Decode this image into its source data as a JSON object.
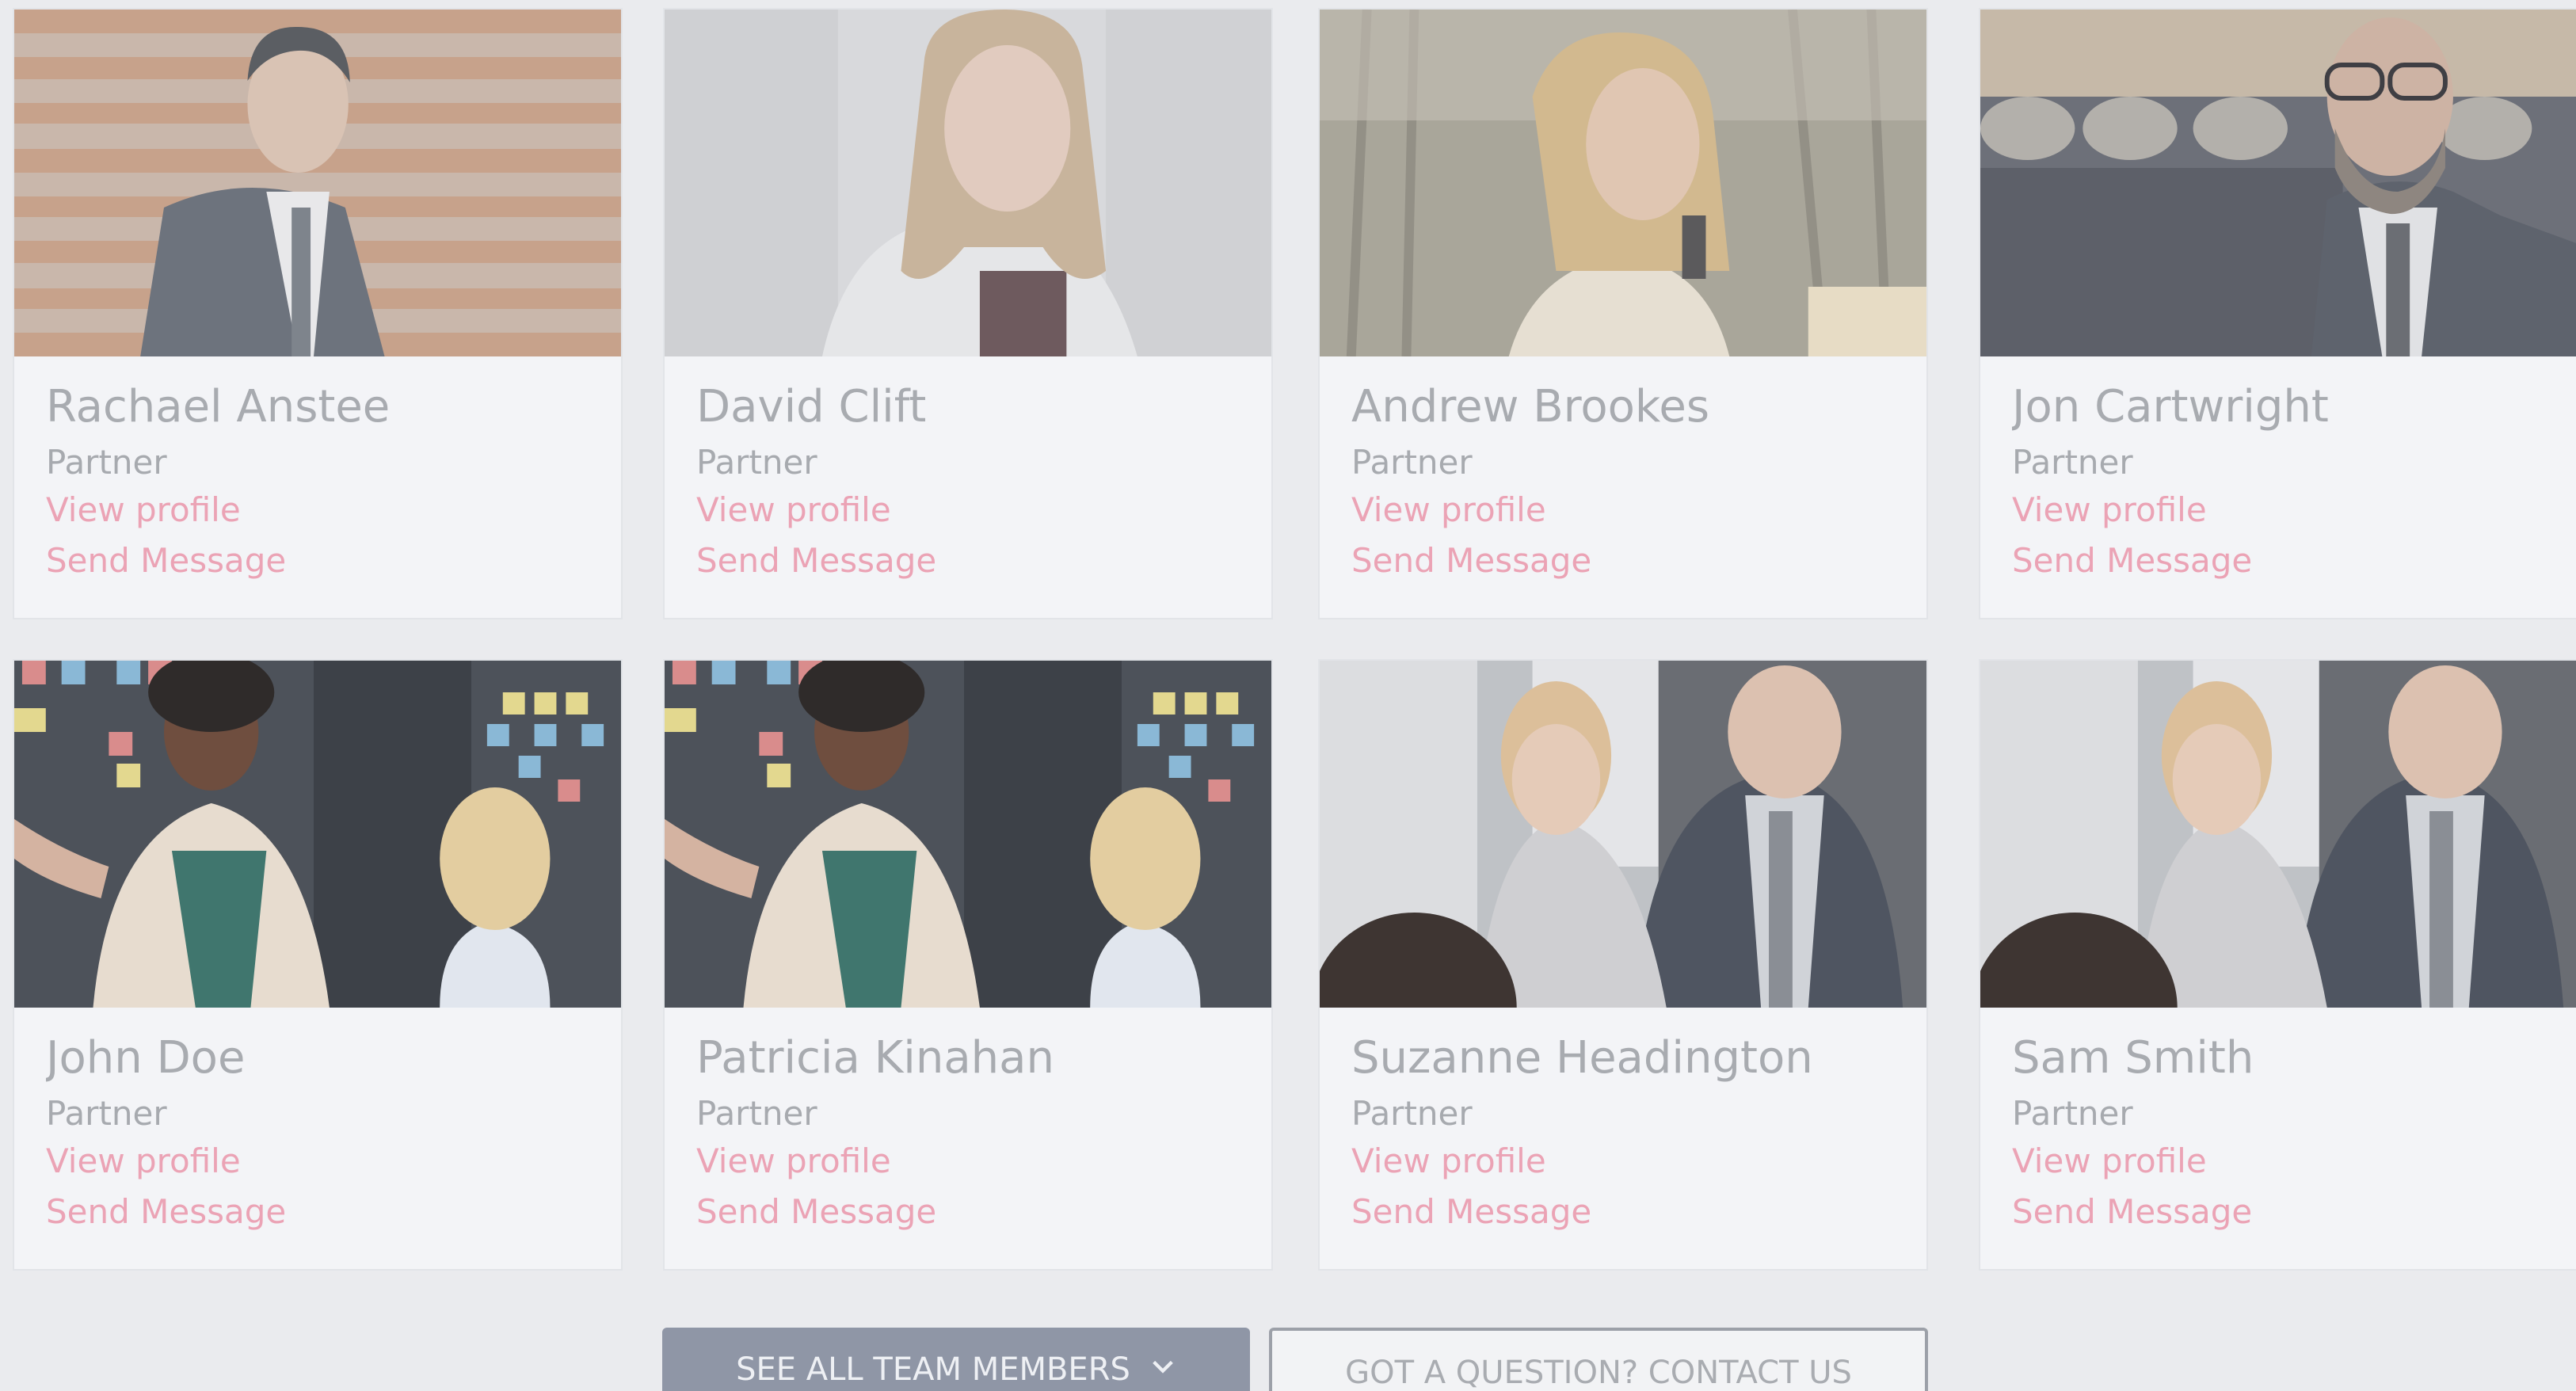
{
  "team": [
    {
      "name": "Rachael Anstee",
      "role": "Partner",
      "view_label": "View profile",
      "message_label": "Send Message",
      "photo": "man-in-suit-against-wood-wall"
    },
    {
      "name": "David Clift",
      "role": "Partner",
      "view_label": "View profile",
      "message_label": "Send Message",
      "photo": "smiling-woman-street"
    },
    {
      "name": "Andrew Brookes",
      "role": "Partner",
      "view_label": "View profile",
      "message_label": "Send Message",
      "photo": "woman-with-phone-outdoors"
    },
    {
      "name": "Jon Cartwright",
      "role": "Partner",
      "view_label": "View profile",
      "message_label": "Send Message",
      "photo": "man-with-glasses"
    },
    {
      "name": "John Doe",
      "role": "Partner",
      "view_label": "View profile",
      "message_label": "Send Message",
      "photo": "woman-presenting-sticky-notes"
    },
    {
      "name": "Patricia Kinahan",
      "role": "Partner",
      "view_label": "View profile",
      "message_label": "Send Message",
      "photo": "woman-presenting-sticky-notes"
    },
    {
      "name": "Suzanne Headington",
      "role": "Partner",
      "view_label": "View profile",
      "message_label": "Send Message",
      "photo": "office-colleagues-laughing"
    },
    {
      "name": "Sam Smith",
      "role": "Partner",
      "view_label": "View profile",
      "message_label": "Send Message",
      "photo": "office-colleagues-laughing"
    }
  ],
  "actions": {
    "see_all_label": "SEE ALL TEAM MEMBERS",
    "see_all_icon": "chevron-down-icon",
    "contact_label": "GOT A QUESTION? CONTACT US"
  },
  "colors": {
    "background": "#eaebee",
    "card": "#f3f4f7",
    "name_text": "#a8abb0",
    "link": "#eba3b5",
    "primary_button": "#8f96a6"
  }
}
